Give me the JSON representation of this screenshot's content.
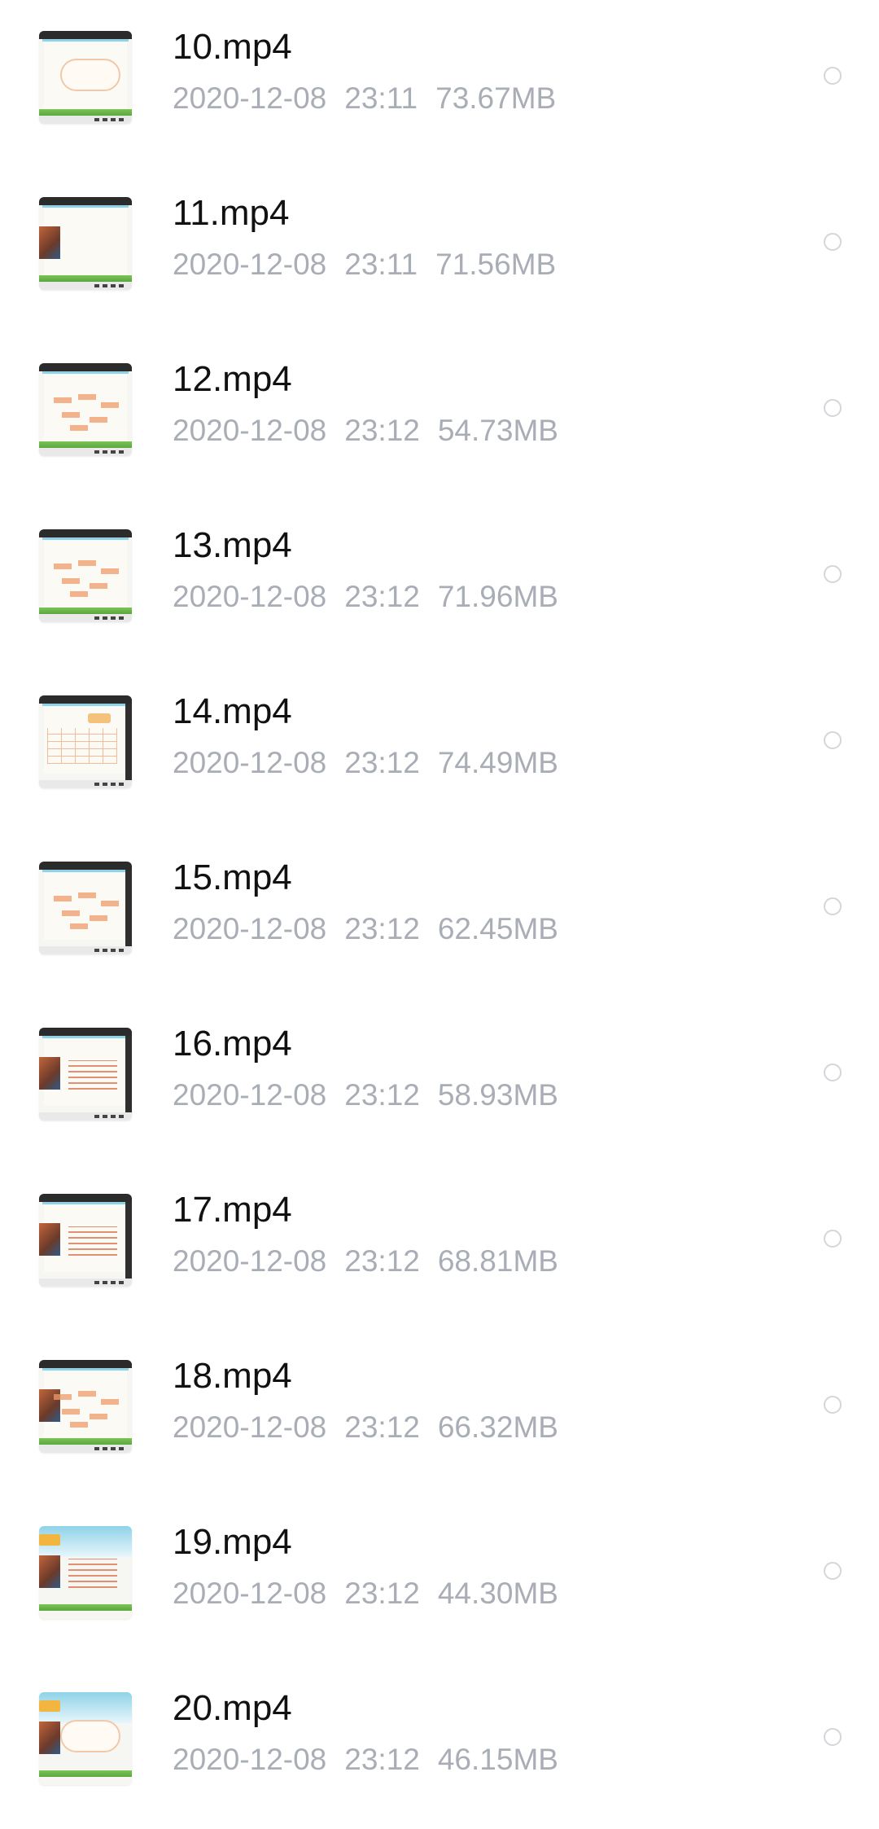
{
  "files": [
    {
      "name": "10.mp4",
      "date": "2020-12-08",
      "time": "23:11",
      "size": "73.67MB",
      "thumb_icon": "video-thumbnail-cloud-icon"
    },
    {
      "name": "11.mp4",
      "date": "2020-12-08",
      "time": "23:11",
      "size": "71.56MB",
      "thumb_icon": "video-thumbnail-picture-icon"
    },
    {
      "name": "12.mp4",
      "date": "2020-12-08",
      "time": "23:12",
      "size": "54.73MB",
      "thumb_icon": "video-thumbnail-mindmap-icon"
    },
    {
      "name": "13.mp4",
      "date": "2020-12-08",
      "time": "23:12",
      "size": "71.96MB",
      "thumb_icon": "video-thumbnail-mindmap-icon"
    },
    {
      "name": "14.mp4",
      "date": "2020-12-08",
      "time": "23:12",
      "size": "74.49MB",
      "thumb_icon": "video-thumbnail-table-icon"
    },
    {
      "name": "15.mp4",
      "date": "2020-12-08",
      "time": "23:12",
      "size": "62.45MB",
      "thumb_icon": "video-thumbnail-mindmap-icon"
    },
    {
      "name": "16.mp4",
      "date": "2020-12-08",
      "time": "23:12",
      "size": "58.93MB",
      "thumb_icon": "video-thumbnail-text-icon"
    },
    {
      "name": "17.mp4",
      "date": "2020-12-08",
      "time": "23:12",
      "size": "68.81MB",
      "thumb_icon": "video-thumbnail-text-icon"
    },
    {
      "name": "18.mp4",
      "date": "2020-12-08",
      "time": "23:12",
      "size": "66.32MB",
      "thumb_icon": "video-thumbnail-picture-icon"
    },
    {
      "name": "19.mp4",
      "date": "2020-12-08",
      "time": "23:12",
      "size": "44.30MB",
      "thumb_icon": "video-thumbnail-scene-icon"
    },
    {
      "name": "20.mp4",
      "date": "2020-12-08",
      "time": "23:12",
      "size": "46.15MB",
      "thumb_icon": "video-thumbnail-scene-icon"
    }
  ],
  "colors": {
    "name_text": "#111111",
    "meta_text": "#a9adb6",
    "radio_border": "#d4d6db",
    "background": "#ffffff"
  }
}
